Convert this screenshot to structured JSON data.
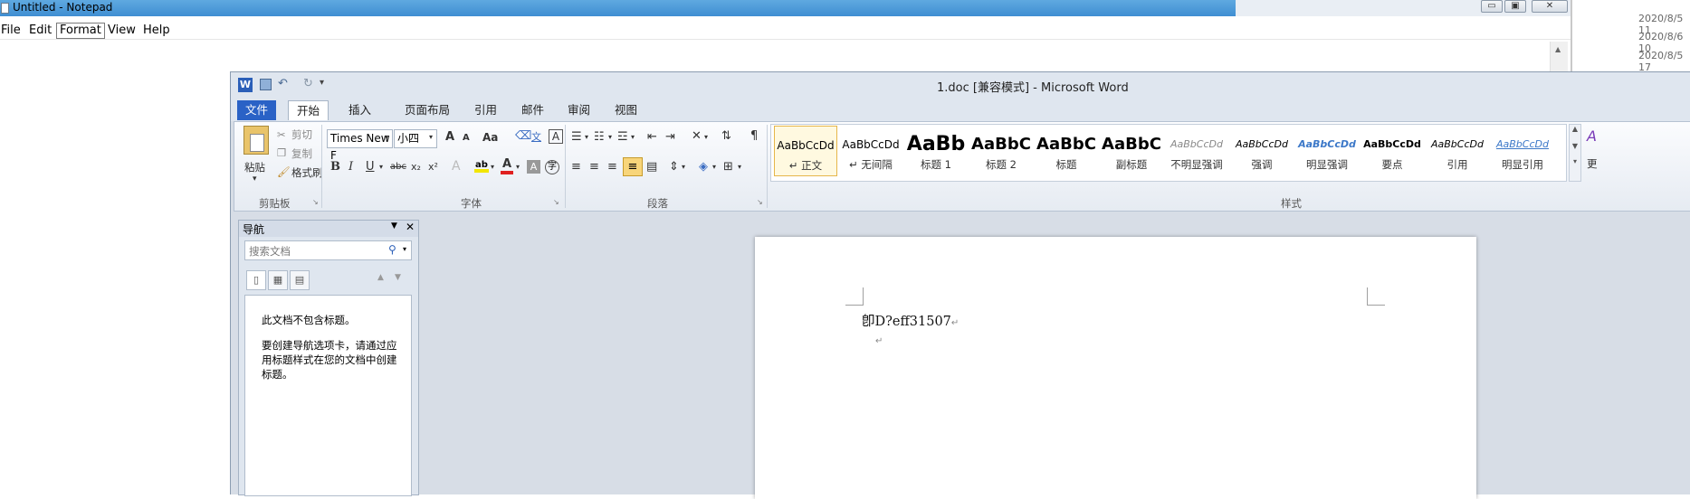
{
  "notepad": {
    "title": "Untitled - Notepad",
    "menu": [
      "File",
      "Edit",
      "Format",
      "View",
      "Help"
    ],
    "window_buttons": {
      "minimize": "▭",
      "maximize": "▣",
      "close": "✕"
    }
  },
  "desktop": {
    "dates": [
      "2020/8/5 11",
      "2020/8/6 10",
      "2020/8/5 17"
    ]
  },
  "word": {
    "title": "1.doc [兼容模式] - Microsoft Word",
    "tabs": [
      "文件",
      "开始",
      "插入",
      "页面布局",
      "引用",
      "邮件",
      "审阅",
      "视图"
    ],
    "active_tab": "开始",
    "clipboard": {
      "paste": "粘贴",
      "cut": "剪切",
      "copy": "复制",
      "format_painter": "格式刷",
      "group": "剪贴板"
    },
    "font": {
      "name": "Times New F",
      "size": "小四",
      "group": "字体",
      "grow": "A",
      "shrink": "A",
      "change_case": "Aa",
      "bold": "B",
      "italic": "I",
      "underline": "U",
      "strike": "abc",
      "subscript": "x₂",
      "superscript": "x²"
    },
    "paragraph": {
      "group": "段落"
    },
    "styles": {
      "group": "样式",
      "more_label": "更",
      "items": [
        {
          "sample": "AaBbCcDd",
          "name": "↵ 正文"
        },
        {
          "sample": "AaBbCcDd",
          "name": "↵ 无间隔"
        },
        {
          "sample": "AaBb",
          "name": "标题 1"
        },
        {
          "sample": "AaBbC",
          "name": "标题 2"
        },
        {
          "sample": "AaBbC",
          "name": "标题"
        },
        {
          "sample": "AaBbC",
          "name": "副标题"
        },
        {
          "sample": "AaBbCcDd",
          "name": "不明显强调"
        },
        {
          "sample": "AaBbCcDd",
          "name": "强调"
        },
        {
          "sample": "AaBbCcDd",
          "name": "明显强调"
        },
        {
          "sample": "AaBbCcDd",
          "name": "要点"
        },
        {
          "sample": "AaBbCcDd",
          "name": "引用"
        },
        {
          "sample": "AaBbCcDd",
          "name": "明显引用"
        }
      ]
    },
    "nav": {
      "title": "导航",
      "search_placeholder": "搜索文档",
      "msg1": "此文档不包含标题。",
      "msg2": "要创建导航选项卡，请通过应用标题样式在您的文档中创建标题。"
    },
    "document": {
      "line1": "卽D?eff31507",
      "para_mark": "↵"
    }
  }
}
